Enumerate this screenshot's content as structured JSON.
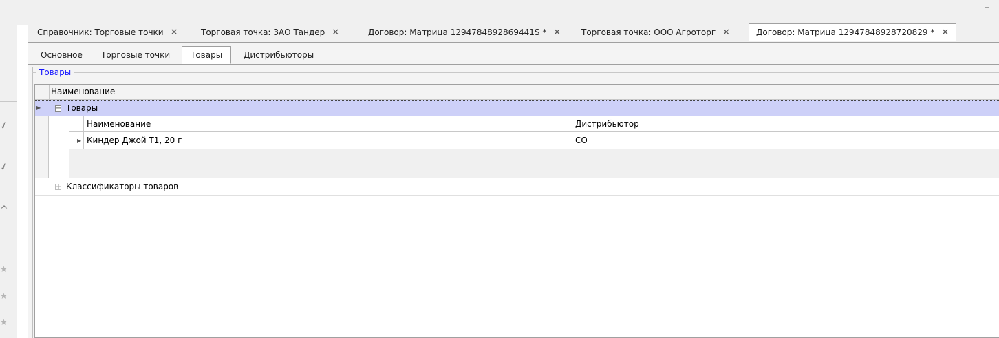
{
  "window": {
    "minimize": "–"
  },
  "doc_tabs": [
    {
      "label": "Справочник: Торговые точки",
      "close": "✕"
    },
    {
      "label": "Торговая точка:  ЗАО Тандер",
      "close": "✕"
    },
    {
      "label": "Договор: Матрица 1294784892869441S *",
      "close": "✕"
    },
    {
      "label": "Торговая точка:  ООО Агроторг",
      "close": "✕"
    },
    {
      "label": "Договор: Матрица 12947848928720829 *",
      "close": "✕"
    }
  ],
  "inner_tabs": [
    "Основное",
    "Торговые точки",
    "Товары",
    "Дистрибьюторы"
  ],
  "group": {
    "title": "Товары"
  },
  "grid": {
    "header": "Наименование",
    "group_row": "Товары",
    "detail": {
      "columns": [
        "Наименование",
        "Дистрибьютор"
      ],
      "rows": [
        {
          "name": "Киндер Джой Т1, 20 г",
          "distributor": "СО"
        }
      ]
    },
    "row3": "Классификаторы товаров"
  },
  "left_icons": {
    "check1": "✓",
    "check2": "✓",
    "caret": "^",
    "star": "★"
  }
}
